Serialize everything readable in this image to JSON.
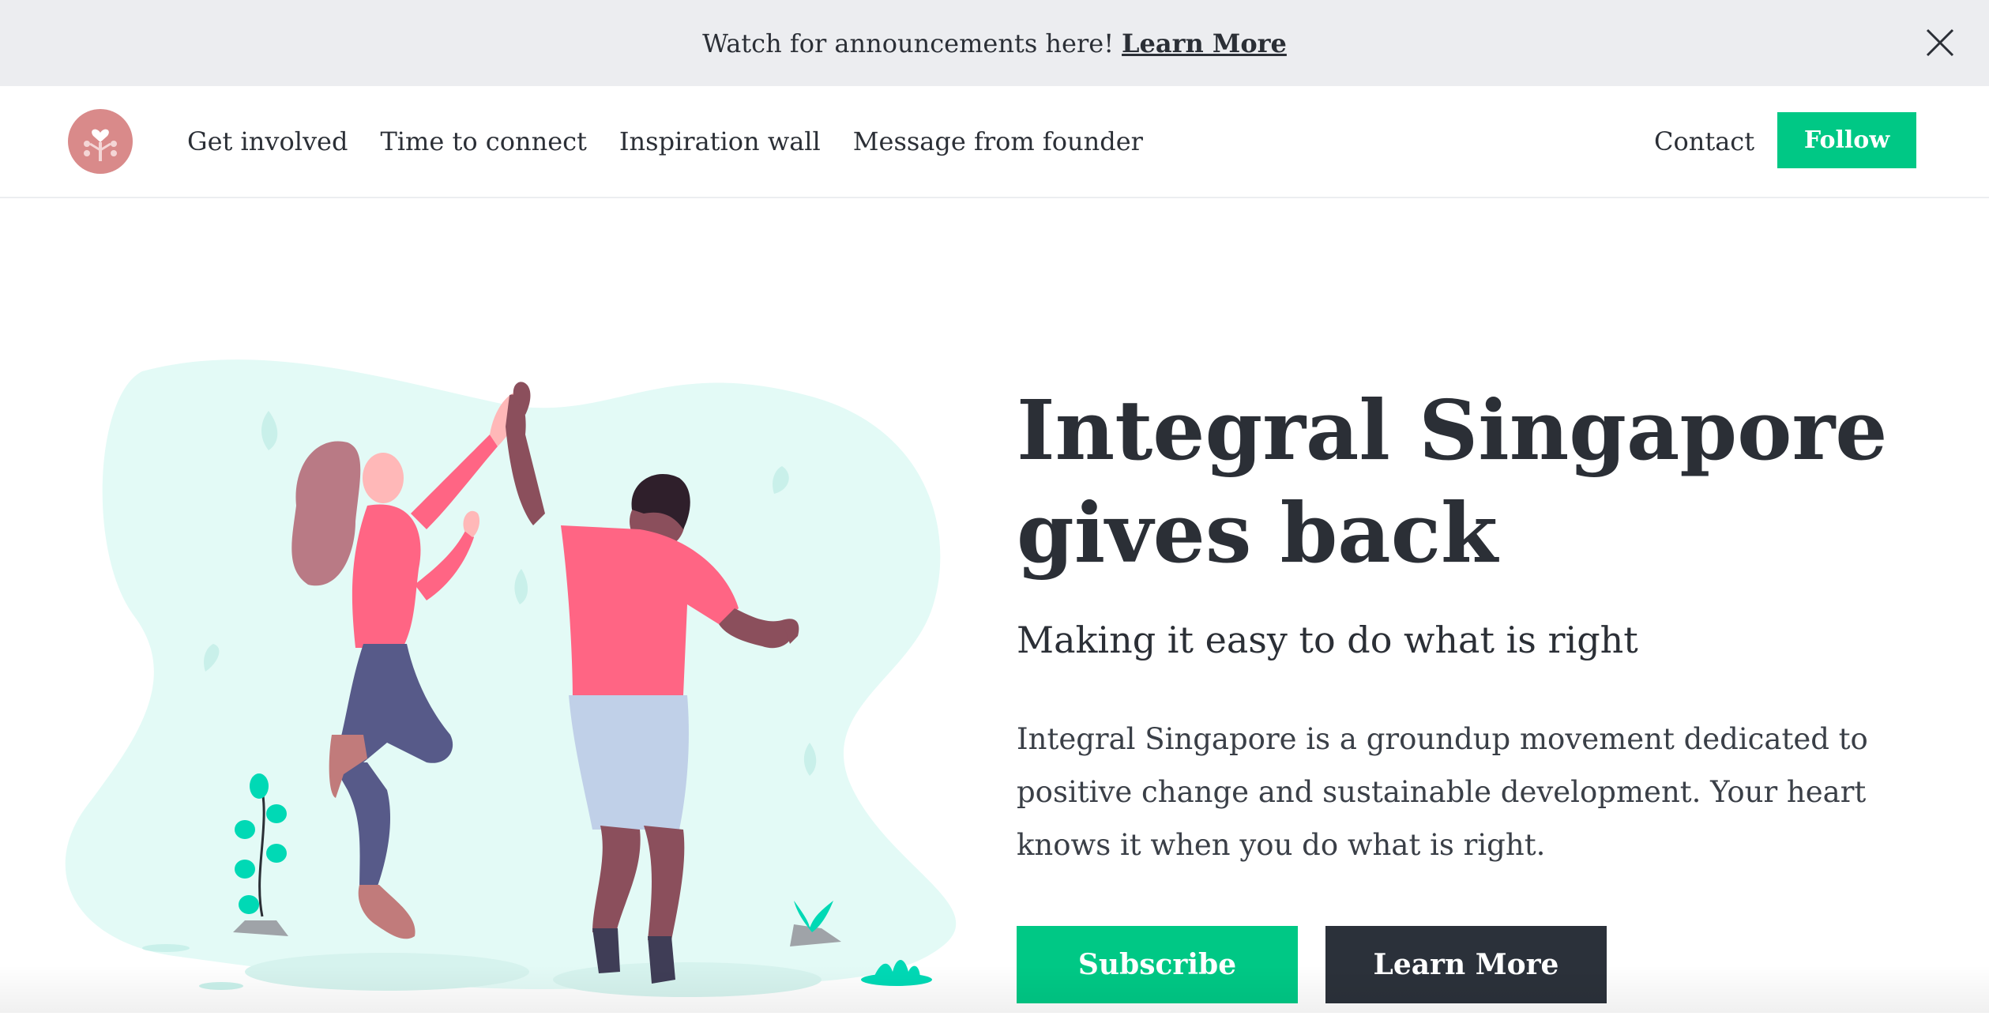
{
  "announcement": {
    "text": "Watch for announcements here!",
    "link_label": "Learn More",
    "close_icon": "close-icon"
  },
  "nav": {
    "logo_icon": "tree-heart-logo-icon",
    "links": [
      "Get involved",
      "Time to connect",
      "Inspiration wall",
      "Message from founder"
    ],
    "contact_label": "Contact",
    "follow_label": "Follow"
  },
  "hero": {
    "title_line1": "Integral Singapore",
    "title_line2": "gives back",
    "subtitle": "Making it easy to do what is right",
    "body": "Integral Singapore is a groundup movement dedicated to positive change and sustainable development. Your heart knows it when you do what is right.",
    "subscribe_label": "Subscribe",
    "learn_more_label": "Learn More",
    "illustration_icon": "high-five-illustration"
  },
  "colors": {
    "accent": "#00c885",
    "dark": "#2b313a",
    "logo": "#d98a8a",
    "illustration_bg": "#e3faf6"
  }
}
